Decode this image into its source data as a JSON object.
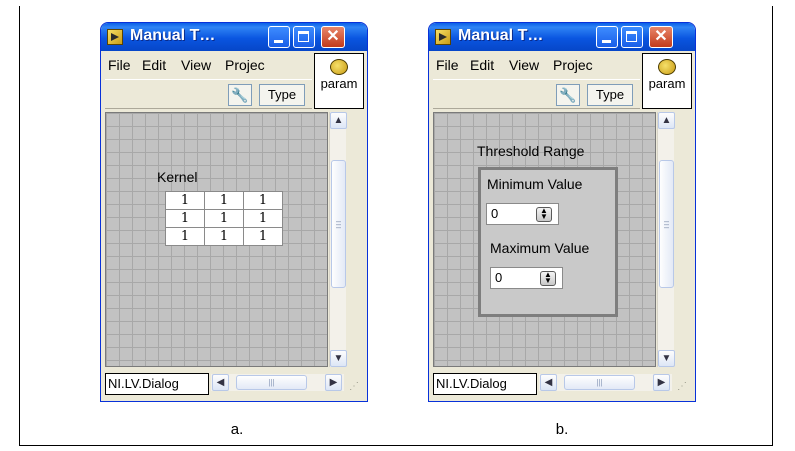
{
  "windows": [
    {
      "title": "Manual T…",
      "menus": [
        "File",
        "Edit",
        "View",
        "Projec"
      ],
      "toolbar": {
        "type_label": "Type",
        "param_label": "param"
      },
      "status_tab": "NI.LV.Dialog",
      "kernel": {
        "label": "Kernel",
        "rows": [
          [
            "1",
            "1",
            "1"
          ],
          [
            "1",
            "1",
            "1"
          ],
          [
            "1",
            "1",
            "1"
          ]
        ]
      }
    },
    {
      "title": "Manual T…",
      "menus": [
        "File",
        "Edit",
        "View",
        "Projec"
      ],
      "toolbar": {
        "type_label": "Type",
        "param_label": "param"
      },
      "status_tab": "NI.LV.Dialog",
      "threshold": {
        "label": "Threshold Range",
        "min_label": "Minimum Value",
        "min_value": "0",
        "max_label": "Maximum Value",
        "max_value": "0"
      }
    }
  ],
  "captions": [
    "a.",
    "b."
  ]
}
